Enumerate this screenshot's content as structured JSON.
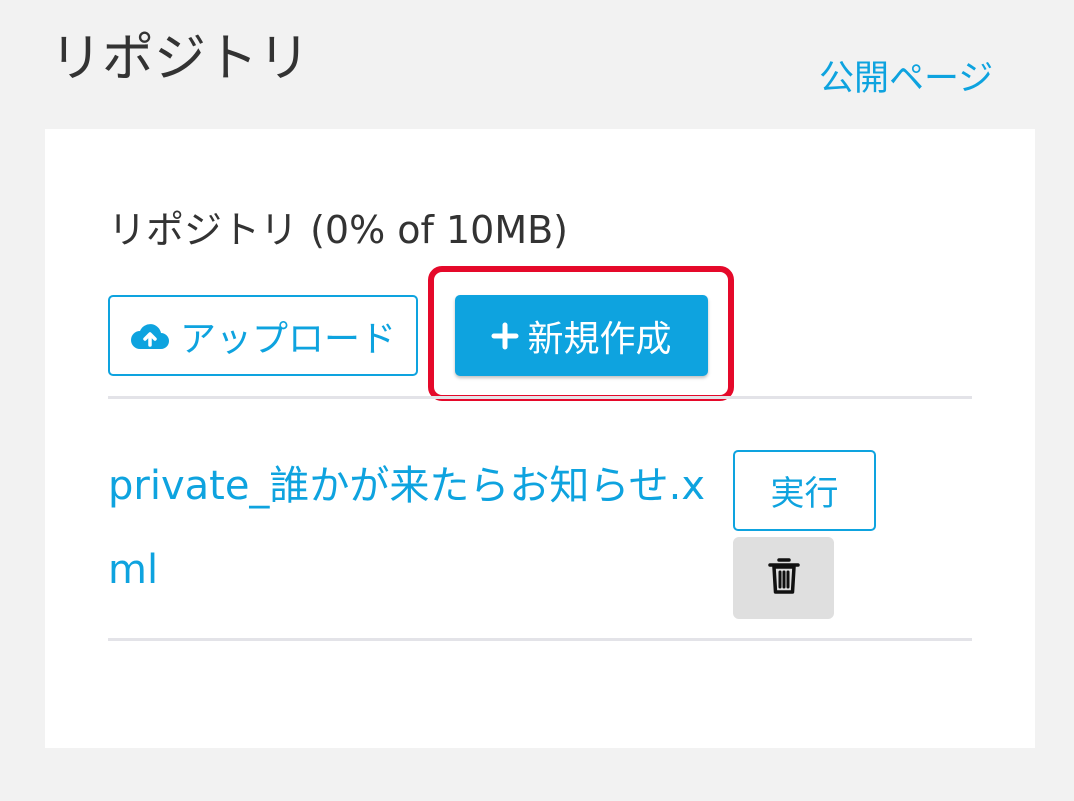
{
  "header": {
    "title": "リポジトリ",
    "public_page_link": "公開ページ"
  },
  "repository": {
    "heading": "リポジトリ (0% of 10MB)",
    "upload_label": "アップロード",
    "new_label": "新規作成",
    "files": [
      {
        "name": "private_誰かが来たらお知らせ.xml",
        "run_label": "実行"
      }
    ]
  },
  "icons": {
    "upload": "cloud-upload-icon",
    "new": "plus-icon",
    "delete": "trash-icon"
  },
  "colors": {
    "accent": "#0ea3df",
    "highlight": "#e5092a",
    "background": "#f2f2f2",
    "delete_button_bg": "#dfdfdf"
  }
}
